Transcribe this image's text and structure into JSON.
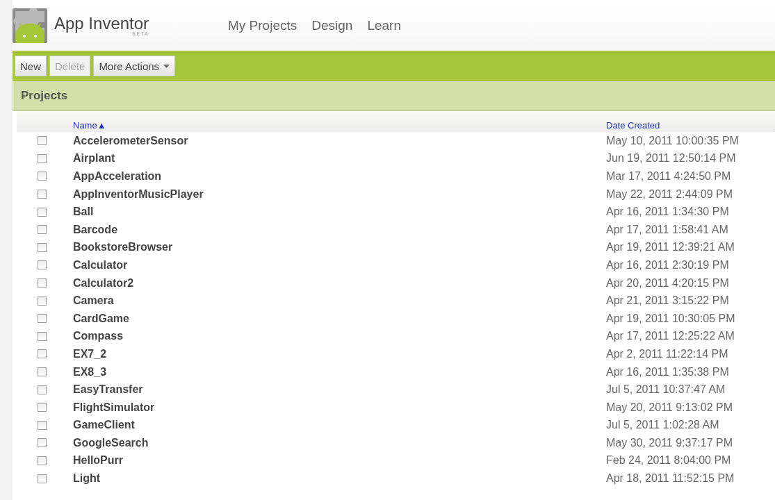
{
  "header": {
    "app_name": "App Inventor",
    "badge": "BETA",
    "nav": [
      {
        "label": "My Projects"
      },
      {
        "label": "Design"
      },
      {
        "label": "Learn"
      }
    ]
  },
  "toolbar": {
    "buttons": [
      {
        "label": "New",
        "disabled": false,
        "kind": "plain"
      },
      {
        "label": "Delete",
        "disabled": true,
        "kind": "plain"
      },
      {
        "label": "More Actions",
        "disabled": false,
        "kind": "dropdown"
      }
    ]
  },
  "panel": {
    "title": "Projects"
  },
  "table": {
    "columns": [
      {
        "label": "Name",
        "sort": "▲"
      },
      {
        "label": "Date Created"
      }
    ],
    "rows": [
      {
        "name": "AccelerometerSensor",
        "date": "May 10, 2011 10:00:35 PM",
        "checked": false
      },
      {
        "name": "Airplant",
        "date": "Jun 19, 2011 12:50:14 PM",
        "checked": false
      },
      {
        "name": "AppAcceleration",
        "date": "Mar 17, 2011 4:24:50 PM",
        "checked": false
      },
      {
        "name": "AppInventorMusicPlayer",
        "date": "May 22, 2011 2:44:09 PM",
        "checked": false
      },
      {
        "name": "Ball",
        "date": "Apr 16, 2011 1:34:30 PM",
        "checked": false
      },
      {
        "name": "Barcode",
        "date": "Apr 17, 2011 1:58:41 AM",
        "checked": false
      },
      {
        "name": "BookstoreBrowser",
        "date": "Apr 19, 2011 12:39:21 AM",
        "checked": false
      },
      {
        "name": "Calculator",
        "date": "Apr 16, 2011 2:30:19 PM",
        "checked": false
      },
      {
        "name": "Calculator2",
        "date": "Apr 20, 2011 4:20:15 PM",
        "checked": false
      },
      {
        "name": "Camera",
        "date": "Apr 21, 2011 3:15:22 PM",
        "checked": false
      },
      {
        "name": "CardGame",
        "date": "Apr 19, 2011 10:30:05 PM",
        "checked": false
      },
      {
        "name": "Compass",
        "date": "Apr 17, 2011 12:25:22 AM",
        "checked": false
      },
      {
        "name": "EX7_2",
        "date": "Apr 2, 2011 11:22:14 PM",
        "checked": false
      },
      {
        "name": "EX8_3",
        "date": "Apr 16, 2011 1:35:38 PM",
        "checked": false
      },
      {
        "name": "EasyTransfer",
        "date": "Jul 5, 2011 10:37:47 AM",
        "checked": false
      },
      {
        "name": "FlightSimulator",
        "date": "May 20, 2011 9:13:02 PM",
        "checked": false
      },
      {
        "name": "GameClient",
        "date": "Jul 5, 2011 1:02:28 AM",
        "checked": false
      },
      {
        "name": "GoogleSearch",
        "date": "May 30, 2011 9:37:17 PM",
        "checked": false
      },
      {
        "name": "HelloPurr",
        "date": "Feb 24, 2011 8:04:00 PM",
        "checked": false
      },
      {
        "name": "Light",
        "date": "Apr 18, 2011 11:52:15 PM",
        "checked": false
      }
    ]
  }
}
